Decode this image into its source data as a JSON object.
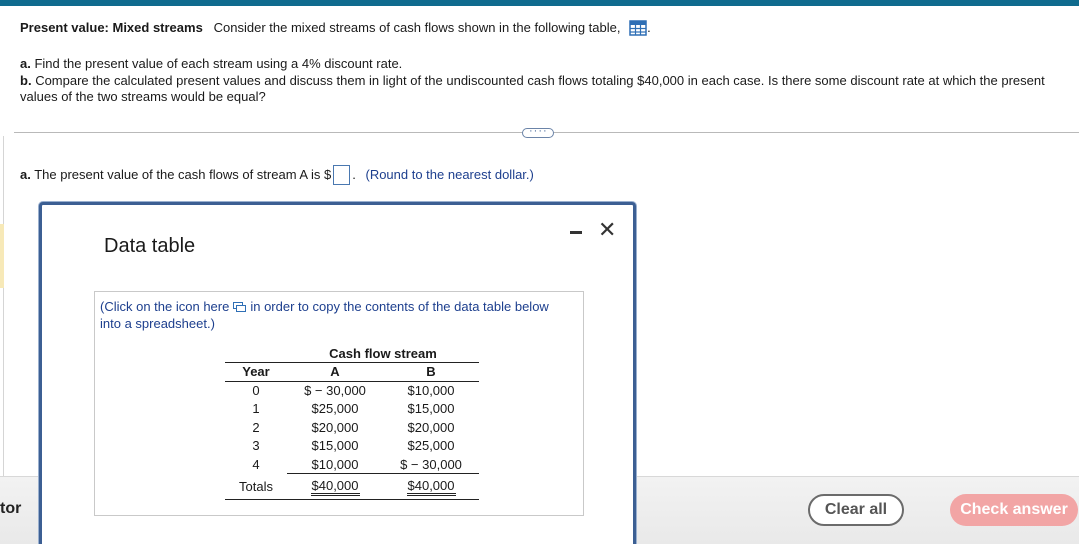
{
  "problem": {
    "title_bold": "Present value: Mixed streams",
    "title_text": "Consider the mixed streams of cash flows shown in the following table,",
    "title_end": ".",
    "part_a_label": "a.",
    "part_a_text": "Find the present value of each stream using a 4% discount rate.",
    "part_b_label": "b.",
    "part_b_text": "Compare the calculated present values and discuss them in light of the undiscounted cash flows totaling $40,000 in each case. Is there some discount rate at which the present values of the two streams would be equal?"
  },
  "more_indicator": "····",
  "answer": {
    "label_bold": "a.",
    "prefix": "The present value of the cash flows of stream A is $",
    "suffix": ".",
    "hint": "(Round to the nearest dollar.)"
  },
  "dialog": {
    "title": "Data table",
    "minimize": "‒",
    "close": "✕",
    "copy_note_start": "(Click on the icon here",
    "copy_note_end": "in order to copy the contents of the data table below into a spreadsheet.)",
    "table": {
      "group_header": "Cash flow stream",
      "col_year": "Year",
      "col_a": "A",
      "col_b": "B",
      "rows": [
        {
          "year": "0",
          "a": "$ − 30,000",
          "b": "$10,000"
        },
        {
          "year": "1",
          "a": "$25,000",
          "b": "$15,000"
        },
        {
          "year": "2",
          "a": "$20,000",
          "b": "$20,000"
        },
        {
          "year": "3",
          "a": "$15,000",
          "b": "$25,000"
        },
        {
          "year": "4",
          "a": "$10,000",
          "b": "$ − 30,000"
        }
      ],
      "totals_label": "Totals",
      "total_a": "$40,000",
      "total_b": "$40,000"
    }
  },
  "footer": {
    "left_label": "tor",
    "clear_all": "Clear all",
    "check_answer": "Check answer"
  },
  "colors": {
    "top_bar": "#0f6b8e",
    "dialog_border": "#3c5f93",
    "link_blue": "#1d3f8e",
    "check_button": "#f2a5a5"
  }
}
